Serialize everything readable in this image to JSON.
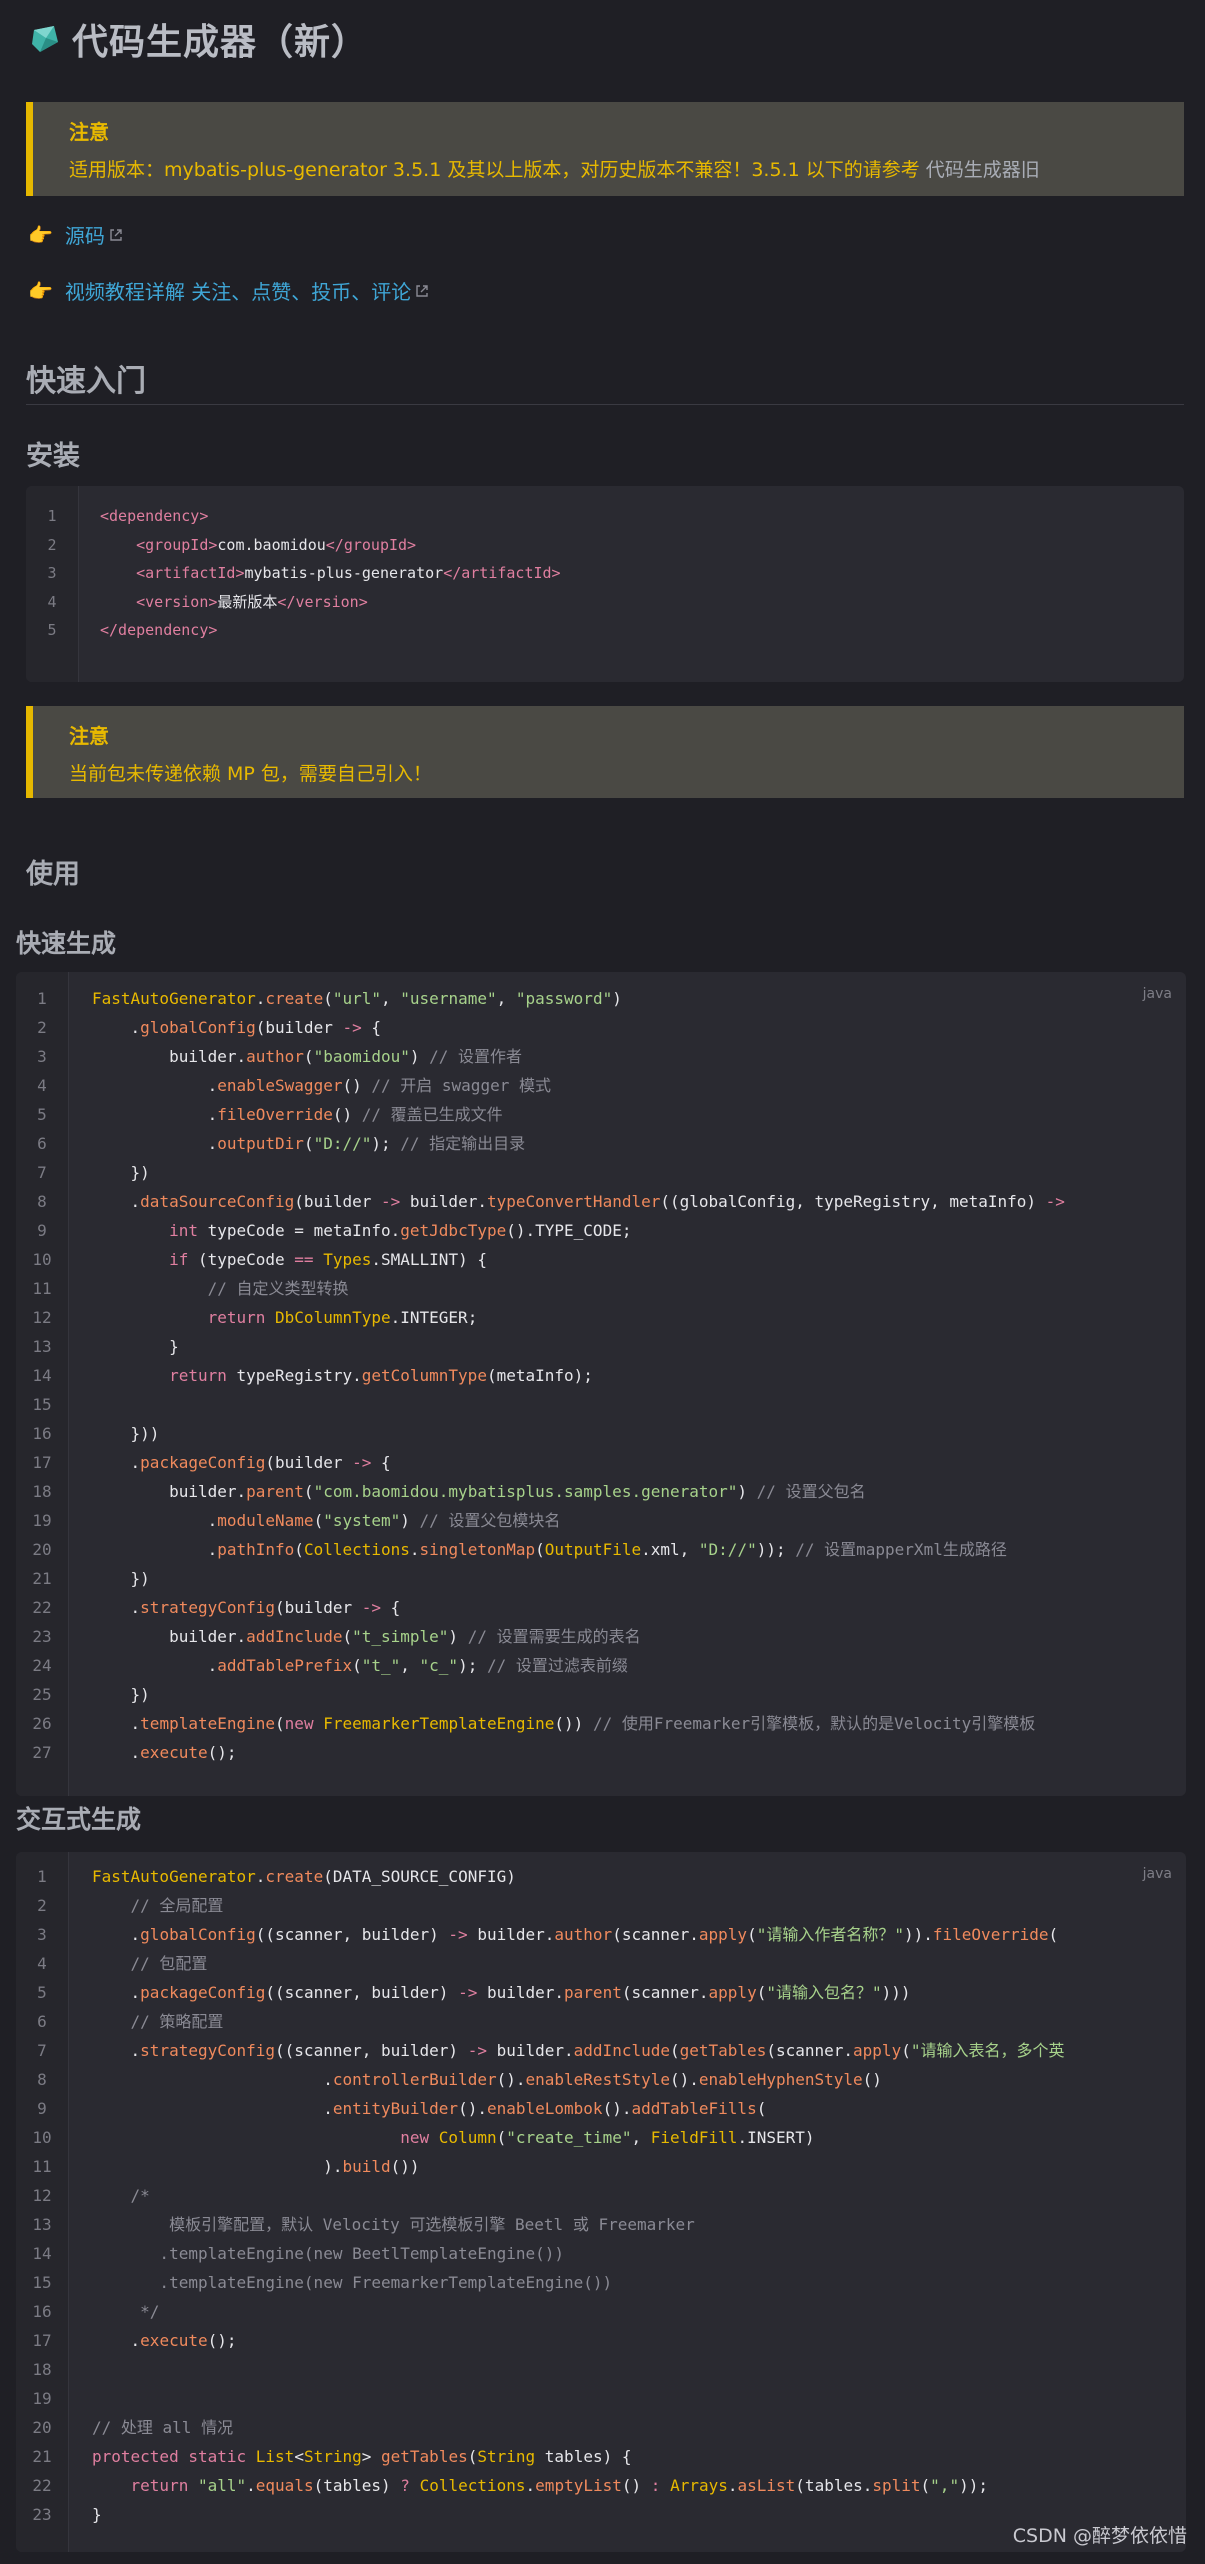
{
  "title": "代码生成器（新）",
  "notice1": {
    "title": "注意",
    "text": "适用版本：mybatis-plus-generator 3.5.1 及其以上版本，对历史版本不兼容！3.5.1 以下的请参考 ",
    "link": "代码生成器旧"
  },
  "links": [
    {
      "text": "源码"
    },
    {
      "text": "视频教程详解 关注、点赞、投币、评论"
    }
  ],
  "h_quickstart": "快速入门",
  "h_install": "安装",
  "install_code": [
    {
      "n": "1",
      "html": "<span class=\"tag\">&lt;dependency&gt;</span>"
    },
    {
      "n": "2",
      "html": "    <span class=\"tag\">&lt;groupId&gt;</span>com.baomidou<span class=\"tag\">&lt;/groupId&gt;</span>"
    },
    {
      "n": "3",
      "html": "    <span class=\"tag\">&lt;artifactId&gt;</span>mybatis-plus-generator<span class=\"tag\">&lt;/artifactId&gt;</span>"
    },
    {
      "n": "4",
      "html": "    <span class=\"tag\">&lt;version&gt;</span>最新版本<span class=\"tag\">&lt;/version&gt;</span>"
    },
    {
      "n": "5",
      "html": "<span class=\"tag\">&lt;/dependency&gt;</span>"
    }
  ],
  "notice2": {
    "title": "注意",
    "text": "当前包未传递依赖 MP 包，需要自己引入！"
  },
  "h_usage": "使用",
  "h_fast": "快速生成",
  "fast_lang": "java",
  "fast_code": [
    {
      "n": "1",
      "html": "<span class=\"cls\">FastAutoGenerator</span>.<span class=\"f\">create</span>(<span class=\"s\">\"url\"</span>, <span class=\"s\">\"username\"</span>, <span class=\"s\">\"password\"</span>)"
    },
    {
      "n": "2",
      "html": "    .<span class=\"f\">globalConfig</span>(builder <span class=\"k\">-&gt;</span> {"
    },
    {
      "n": "3",
      "html": "        builder.<span class=\"f\">author</span>(<span class=\"s\">\"baomidou\"</span>) <span class=\"c\">// 设置作者</span>"
    },
    {
      "n": "4",
      "html": "            .<span class=\"f\">enableSwagger</span>() <span class=\"c\">// 开启 swagger 模式</span>"
    },
    {
      "n": "5",
      "html": "            .<span class=\"f\">fileOverride</span>() <span class=\"c\">// 覆盖已生成文件</span>"
    },
    {
      "n": "6",
      "html": "            .<span class=\"f\">outputDir</span>(<span class=\"s\">\"D://\"</span>); <span class=\"c\">// 指定输出目录</span>"
    },
    {
      "n": "7",
      "html": "    })"
    },
    {
      "n": "8",
      "html": "    .<span class=\"f\">dataSourceConfig</span>(builder <span class=\"k\">-&gt;</span> builder.<span class=\"f\">typeConvertHandler</span>((globalConfig, typeRegistry, metaInfo) <span class=\"k\">-&gt;</span>"
    },
    {
      "n": "9",
      "html": "        <span class=\"k\">int</span> typeCode = metaInfo.<span class=\"f\">getJdbcType</span>().TYPE_CODE;"
    },
    {
      "n": "10",
      "html": "        <span class=\"k\">if</span> (typeCode <span class=\"k\">==</span> <span class=\"cls\">Types</span>.SMALLINT) {"
    },
    {
      "n": "11",
      "html": "            <span class=\"c\">// 自定义类型转换</span>"
    },
    {
      "n": "12",
      "html": "            <span class=\"k\">return</span> <span class=\"cls\">DbColumnType</span>.INTEGER;"
    },
    {
      "n": "13",
      "html": "        }"
    },
    {
      "n": "14",
      "html": "        <span class=\"k\">return</span> typeRegistry.<span class=\"f\">getColumnType</span>(metaInfo);"
    },
    {
      "n": "15",
      "html": ""
    },
    {
      "n": "16",
      "html": "    }))"
    },
    {
      "n": "17",
      "html": "    .<span class=\"f\">packageConfig</span>(builder <span class=\"k\">-&gt;</span> {"
    },
    {
      "n": "18",
      "html": "        builder.<span class=\"f\">parent</span>(<span class=\"s\">\"com.baomidou.mybatisplus.samples.generator\"</span>) <span class=\"c\">// 设置父包名</span>"
    },
    {
      "n": "19",
      "html": "            .<span class=\"f\">moduleName</span>(<span class=\"s\">\"system\"</span>) <span class=\"c\">// 设置父包模块名</span>"
    },
    {
      "n": "20",
      "html": "            .<span class=\"f\">pathInfo</span>(<span class=\"cls\">Collections</span>.<span class=\"f\">singletonMap</span>(<span class=\"cls\">OutputFile</span>.xml, <span class=\"s\">\"D://\"</span>)); <span class=\"c\">// 设置mapperXml生成路径</span>"
    },
    {
      "n": "21",
      "html": "    })"
    },
    {
      "n": "22",
      "html": "    .<span class=\"f\">strategyConfig</span>(builder <span class=\"k\">-&gt;</span> {"
    },
    {
      "n": "23",
      "html": "        builder.<span class=\"f\">addInclude</span>(<span class=\"s\">\"t_simple\"</span>) <span class=\"c\">// 设置需要生成的表名</span>"
    },
    {
      "n": "24",
      "html": "            .<span class=\"f\">addTablePrefix</span>(<span class=\"s\">\"t_\"</span>, <span class=\"s\">\"c_\"</span>); <span class=\"c\">// 设置过滤表前缀</span>"
    },
    {
      "n": "25",
      "html": "    })"
    },
    {
      "n": "26",
      "html": "    .<span class=\"f\">templateEngine</span>(<span class=\"k\">new</span> <span class=\"cls\">FreemarkerTemplateEngine</span>()) <span class=\"c\">// 使用Freemarker引擎模板，默认的是Velocity引擎模板</span>"
    },
    {
      "n": "27",
      "html": "    .<span class=\"f\">execute</span>();"
    }
  ],
  "h_interactive": "交互式生成",
  "inter_lang": "java",
  "inter_code": [
    {
      "n": "1",
      "html": "<span class=\"cls\">FastAutoGenerator</span>.<span class=\"f\">create</span>(DATA_SOURCE_CONFIG)"
    },
    {
      "n": "2",
      "html": "    <span class=\"c\">// 全局配置</span>"
    },
    {
      "n": "3",
      "html": "    .<span class=\"f\">globalConfig</span>((scanner, builder) <span class=\"k\">-&gt;</span> builder.<span class=\"f\">author</span>(scanner.<span class=\"f\">apply</span>(<span class=\"s\">\"请输入作者名称？\"</span>)).<span class=\"f\">fileOverride</span>("
    },
    {
      "n": "4",
      "html": "    <span class=\"c\">// 包配置</span>"
    },
    {
      "n": "5",
      "html": "    .<span class=\"f\">packageConfig</span>((scanner, builder) <span class=\"k\">-&gt;</span> builder.<span class=\"f\">parent</span>(scanner.<span class=\"f\">apply</span>(<span class=\"s\">\"请输入包名？\"</span>)))"
    },
    {
      "n": "6",
      "html": "    <span class=\"c\">// 策略配置</span>"
    },
    {
      "n": "7",
      "html": "    .<span class=\"f\">strategyConfig</span>((scanner, builder) <span class=\"k\">-&gt;</span> builder.<span class=\"f\">addInclude</span>(<span class=\"f\">getTables</span>(scanner.<span class=\"f\">apply</span>(<span class=\"s\">\"请输入表名，多个英</span>"
    },
    {
      "n": "8",
      "html": "                        .<span class=\"f\">controllerBuilder</span>().<span class=\"f\">enableRestStyle</span>().<span class=\"f\">enableHyphenStyle</span>()"
    },
    {
      "n": "9",
      "html": "                        .<span class=\"f\">entityBuilder</span>().<span class=\"f\">enableLombok</span>().<span class=\"f\">addTableFills</span>("
    },
    {
      "n": "10",
      "html": "                                <span class=\"k\">new</span> <span class=\"cls\">Column</span>(<span class=\"s\">\"create_time\"</span>, <span class=\"cls\">FieldFill</span>.INSERT)"
    },
    {
      "n": "11",
      "html": "                        ).<span class=\"f\">build</span>())"
    },
    {
      "n": "12",
      "html": "    <span class=\"c\">/*</span>"
    },
    {
      "n": "13",
      "html": "<span class=\"c\">        模板引擎配置，默认 Velocity 可选模板引擎 Beetl 或 Freemarker</span>"
    },
    {
      "n": "14",
      "html": "<span class=\"c\">       .templateEngine(new BeetlTemplateEngine())</span>"
    },
    {
      "n": "15",
      "html": "<span class=\"c\">       .templateEngine(new FreemarkerTemplateEngine())</span>"
    },
    {
      "n": "16",
      "html": "<span class=\"c\">     */</span>"
    },
    {
      "n": "17",
      "html": "    .<span class=\"f\">execute</span>();"
    },
    {
      "n": "18",
      "html": ""
    },
    {
      "n": "19",
      "html": ""
    },
    {
      "n": "20",
      "html": "<span class=\"c\">// 处理 all 情况</span>"
    },
    {
      "n": "21",
      "html": "<span class=\"k\">protected</span> <span class=\"k\">static</span> <span class=\"cls\">List</span>&lt;<span class=\"cls\">String</span>&gt; <span class=\"f\">getTables</span>(<span class=\"cls\">String</span> tables) {"
    },
    {
      "n": "22",
      "html": "    <span class=\"k\">return</span> <span class=\"s\">\"all\"</span>.<span class=\"f\">equals</span>(tables) <span class=\"k\">?</span> <span class=\"cls\">Collections</span>.<span class=\"f\">emptyList</span>() <span class=\"k\">:</span> <span class=\"cls\">Arrays</span>.<span class=\"f\">asList</span>(tables.<span class=\"f\">split</span>(<span class=\"s\">\",\"</span>));"
    },
    {
      "n": "23",
      "html": "}"
    }
  ],
  "footer": "CSDN @醉梦依依惜"
}
